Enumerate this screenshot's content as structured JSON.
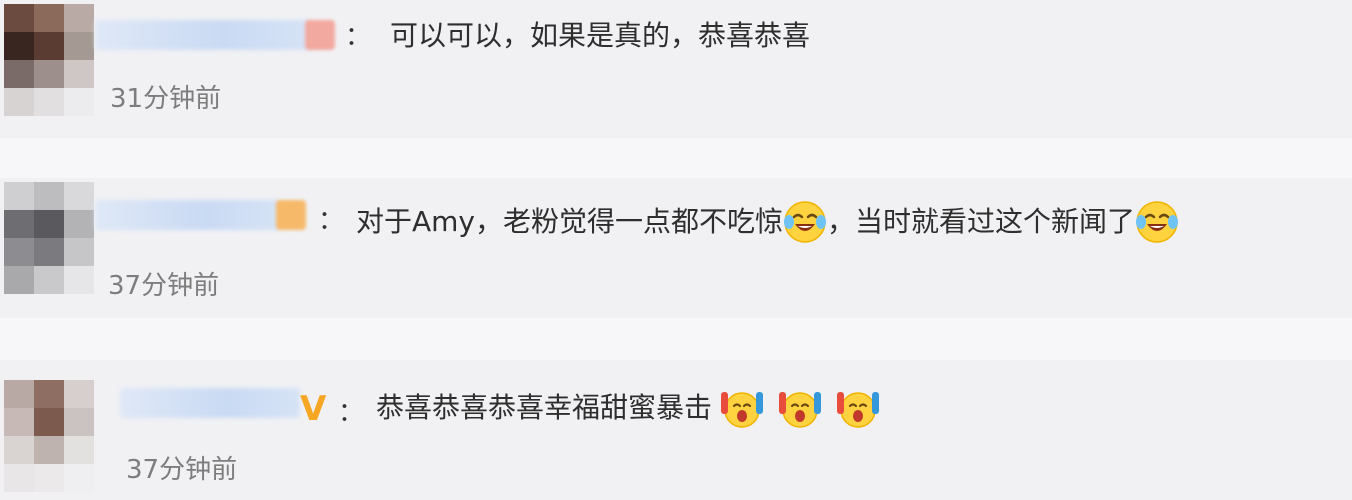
{
  "comments": [
    {
      "separator": "：",
      "text": "可以可以，如果是真的，恭喜恭喜",
      "time": "31分钟前"
    },
    {
      "separator": "：",
      "text_parts": [
        "对于Amy，老粉觉得一点都不吃惊",
        "，当时就看过这个新闻了"
      ],
      "emoji": "laughing-crying-emoji",
      "time": "37分钟前"
    },
    {
      "vip_mark": "V",
      "separator": "：",
      "text": "恭喜恭喜恭喜幸福甜蜜暴击",
      "emoji": "cheering-emoji",
      "time": "37分钟前"
    }
  ],
  "colors": {
    "background": "#f1f1f4",
    "text": "#2e2e2e",
    "time": "#7d7d7d",
    "vip": "#f5a623"
  }
}
